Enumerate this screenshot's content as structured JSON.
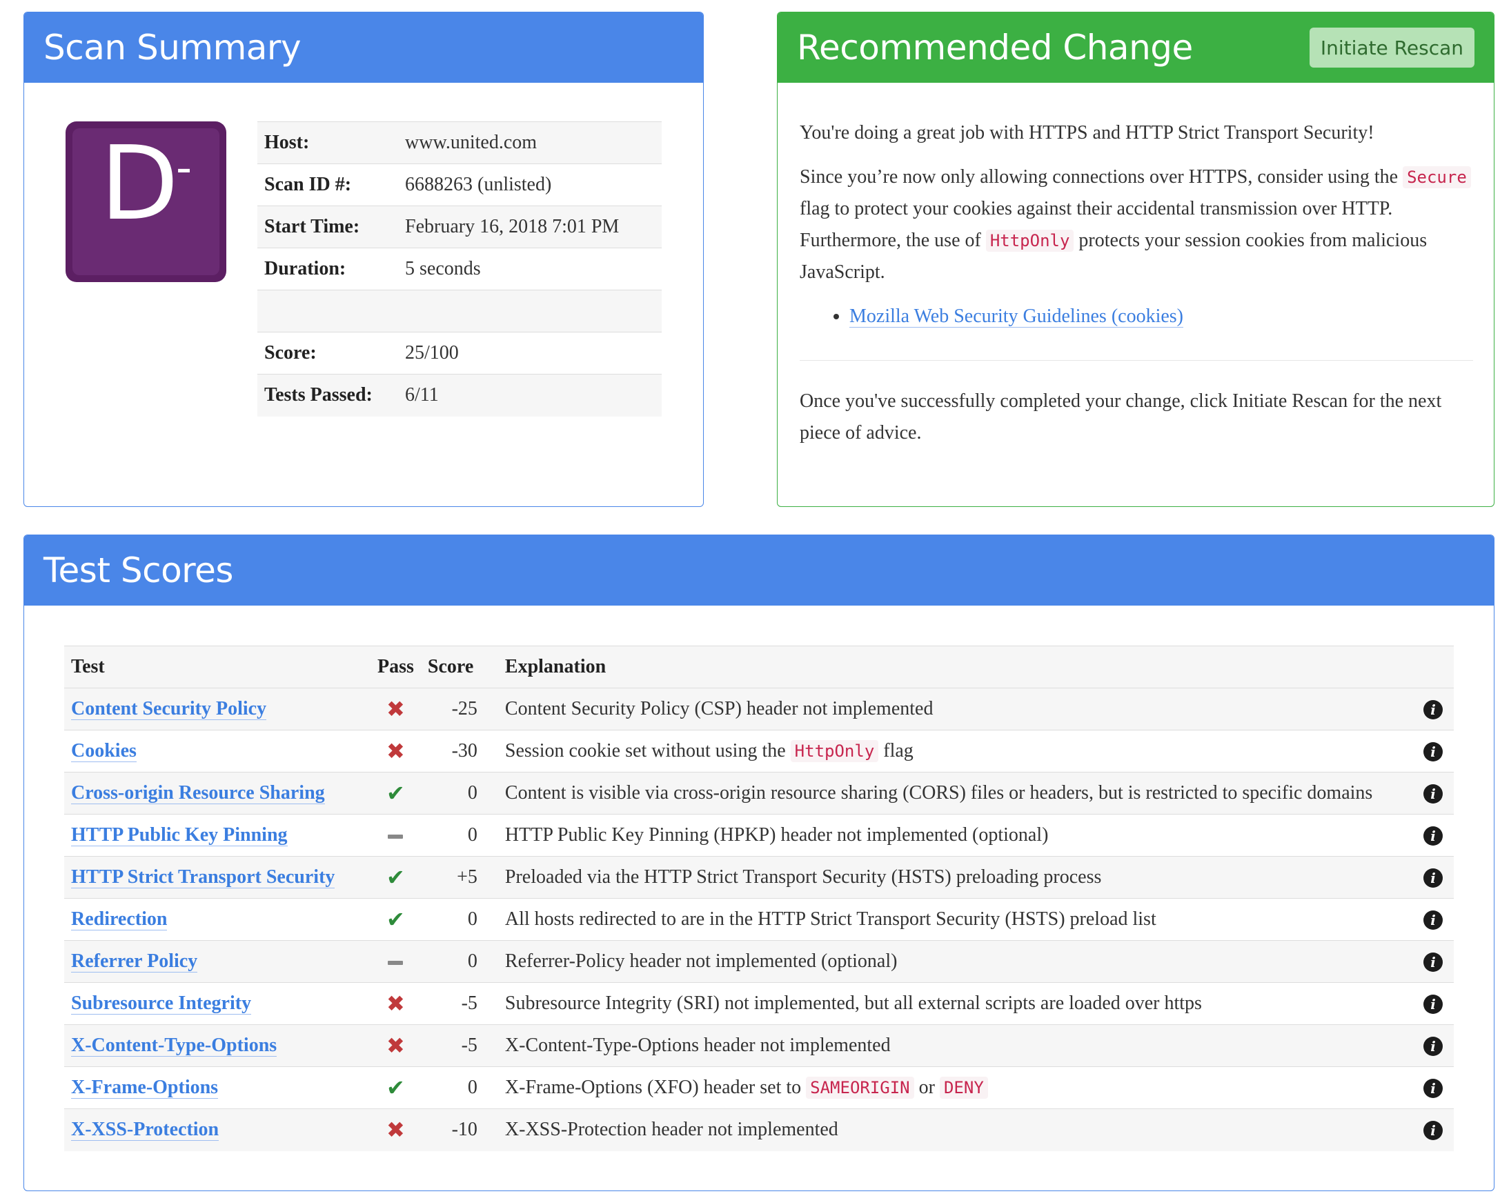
{
  "scan_summary": {
    "title": "Scan Summary",
    "grade": "D",
    "grade_modifier": "-",
    "rows": [
      {
        "label": "Host:",
        "value": "www.united.com"
      },
      {
        "label": "Scan ID #:",
        "value": "6688263 (unlisted)"
      },
      {
        "label": "Start Time:",
        "value": "February 16, 2018 7:01 PM"
      },
      {
        "label": "Duration:",
        "value": "5 seconds"
      },
      {
        "label": "",
        "value": ""
      },
      {
        "label": "Score:",
        "value": "25/100"
      },
      {
        "label": "Tests Passed:",
        "value": "6/11"
      }
    ]
  },
  "recommended_change": {
    "title": "Recommended Change",
    "rescan_button": "Initiate Rescan",
    "intro": "You're doing a great job with HTTPS and HTTP Strict Transport Security!",
    "p2_part1": "Since you’re now only allowing connections over HTTPS, consider using the",
    "p2_code1": "Secure",
    "p2_part2": "flag to protect your cookies against their accidental transmission over HTTP. Furthermore, the use of",
    "p2_code2": "HttpOnly",
    "p2_part3": "protects your session cookies from malicious JavaScript.",
    "link": "Mozilla Web Security Guidelines (cookies)",
    "outro": "Once you've successfully completed your change, click Initiate Rescan for the next piece of advice."
  },
  "test_scores": {
    "title": "Test Scores",
    "headers": {
      "test": "Test",
      "pass": "Pass",
      "score": "Score",
      "explanation": "Explanation"
    },
    "rows": [
      {
        "test": "Content Security Policy",
        "pass": "fail",
        "score": "-25",
        "explanation": "Content Security Policy (CSP) header not implemented"
      },
      {
        "test": "Cookies",
        "pass": "fail",
        "score": "-30",
        "explanation": "Session cookie set without using the",
        "code": "HttpOnly",
        "explanation_after": "flag"
      },
      {
        "test": "Cross-origin Resource Sharing",
        "pass": "pass",
        "score": "0",
        "explanation": "Content is visible via cross-origin resource sharing (CORS) files or headers, but is restricted to specific domains"
      },
      {
        "test": "HTTP Public Key Pinning",
        "pass": "neutral",
        "score": "0",
        "explanation": "HTTP Public Key Pinning (HPKP) header not implemented (optional)"
      },
      {
        "test": "HTTP Strict Transport Security",
        "pass": "pass",
        "score": "+5",
        "explanation": "Preloaded via the HTTP Strict Transport Security (HSTS) preloading process"
      },
      {
        "test": "Redirection",
        "pass": "pass",
        "score": "0",
        "explanation": "All hosts redirected to are in the HTTP Strict Transport Security (HSTS) preload list"
      },
      {
        "test": "Referrer Policy",
        "pass": "neutral",
        "score": "0",
        "explanation": "Referrer-Policy header not implemented (optional)"
      },
      {
        "test": "Subresource Integrity",
        "pass": "fail",
        "score": "-5",
        "explanation": "Subresource Integrity (SRI) not implemented, but all external scripts are loaded over https"
      },
      {
        "test": "X-Content-Type-Options",
        "pass": "fail",
        "score": "-5",
        "explanation": "X-Content-Type-Options header not implemented"
      },
      {
        "test": "X-Frame-Options",
        "pass": "pass",
        "score": "0",
        "explanation": "X-Frame-Options (XFO) header set to",
        "code": "SAMEORIGIN",
        "explanation_mid": "or",
        "code2": "DENY"
      },
      {
        "test": "X-XSS-Protection",
        "pass": "fail",
        "score": "-10",
        "explanation": "X-XSS-Protection header not implemented"
      }
    ]
  },
  "colors": {
    "header_blue": "#4a86e8",
    "header_green": "#3cb043",
    "grade_purple": "#6a2b73",
    "link_blue": "#3b7ee0",
    "fail_red": "#c0393b",
    "pass_green": "#2e8b3a"
  },
  "icons": {
    "fail": "cross-icon",
    "pass": "checkmark-icon",
    "neutral": "dash-icon",
    "info": "info-icon"
  }
}
